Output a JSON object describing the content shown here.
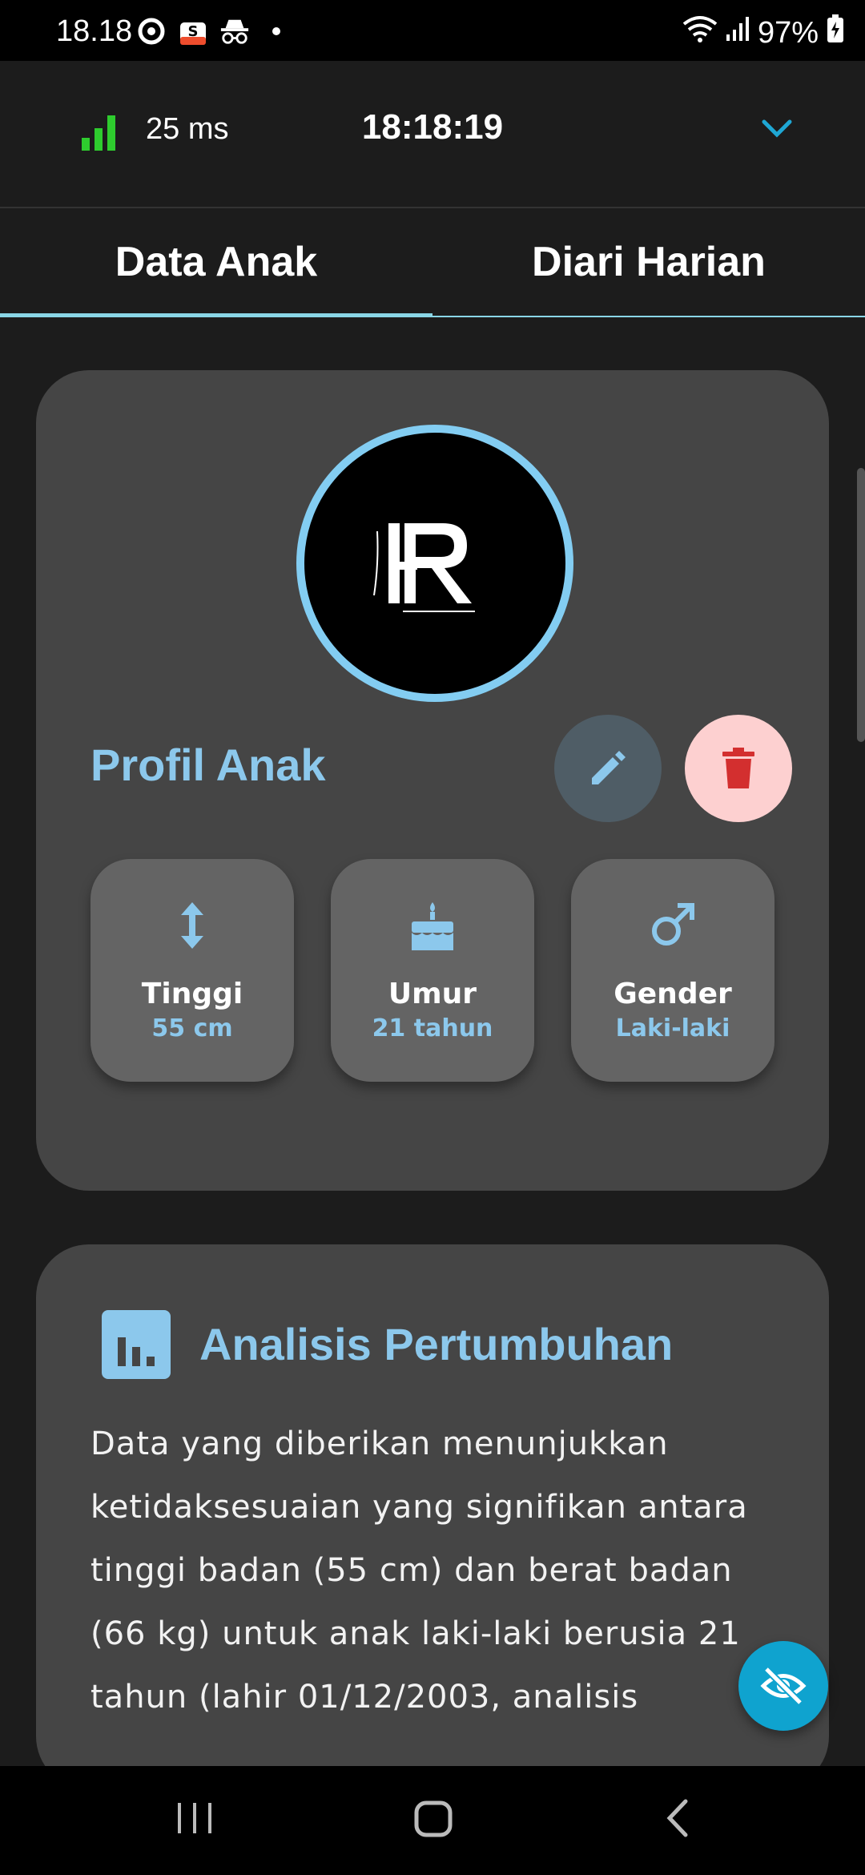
{
  "status_bar": {
    "time": "18.18",
    "battery": "97%"
  },
  "header": {
    "ping": "25 ms",
    "clock": "18:18:19"
  },
  "tabs": [
    {
      "label": "Data Anak",
      "active": true
    },
    {
      "label": "Diari Harian",
      "active": false
    }
  ],
  "profile": {
    "title": "Profil Anak",
    "stats": [
      {
        "label": "Tinggi",
        "value": "55 cm",
        "icon": "height-arrows-icon"
      },
      {
        "label": "Umur",
        "value": "21 tahun",
        "icon": "cake-icon"
      },
      {
        "label": "Gender",
        "value": "Laki-laki",
        "icon": "male-icon"
      }
    ]
  },
  "analysis": {
    "title": "Analisis Pertumbuhan",
    "text": "Data yang diberikan menunjukkan ketidaksesuaian yang signifikan antara tinggi badan (55 cm) dan berat badan (66 kg) untuk anak laki-laki berusia 21 tahun (lahir 01/12/2003, analisis"
  },
  "colors": {
    "accent": "#8cc8ec",
    "fab": "#0fa3cf",
    "delete_bg": "#fdd0d0",
    "delete_icon": "#d32f2f",
    "ping_green": "#2ecc2e"
  }
}
